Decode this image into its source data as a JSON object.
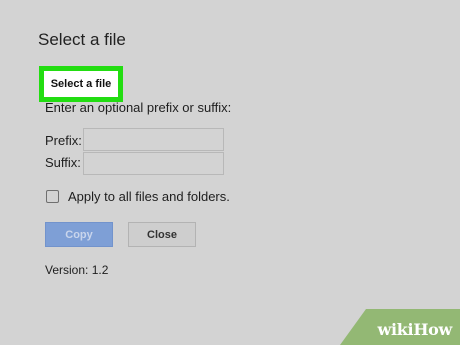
{
  "dialog": {
    "title": "Select a file",
    "select_button_label": "Select a file",
    "hint_text": "Enter an optional prefix or suffix:",
    "prefix_label": "Prefix:",
    "prefix_value": "",
    "suffix_label": "Suffix:",
    "suffix_value": "",
    "apply_all_label": "Apply to all files and folders.",
    "apply_all_checked": false,
    "copy_button_label": "Copy",
    "close_button_label": "Close",
    "version_text": "Version: 1.2"
  },
  "watermark": {
    "part1": "wiki",
    "part2": "How"
  },
  "colors": {
    "background": "#d3d3d3",
    "highlight": "#22dd11",
    "copy_button": "#7e9fd6",
    "watermark_green": "#93b874"
  },
  "icons": {
    "checkbox": "checkbox-unchecked-icon"
  }
}
